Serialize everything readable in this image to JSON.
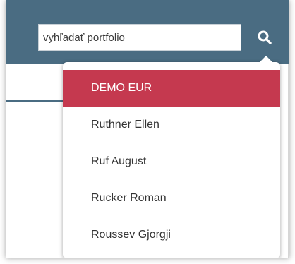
{
  "search": {
    "placeholder": "vyhľadať portfolio",
    "button_icon": "search-icon"
  },
  "dropdown": {
    "items": [
      {
        "label": "DEMO EUR",
        "active": true
      },
      {
        "label": "Ruthner Ellen",
        "active": false
      },
      {
        "label": "Ruf August",
        "active": false
      },
      {
        "label": "Rucker Roman",
        "active": false
      },
      {
        "label": "Roussev Gjorgji",
        "active": false
      }
    ]
  },
  "colors": {
    "header": "#4a6c82",
    "active_item": "#c5394f",
    "active_text": "#ffffff",
    "item_text": "#333333"
  }
}
